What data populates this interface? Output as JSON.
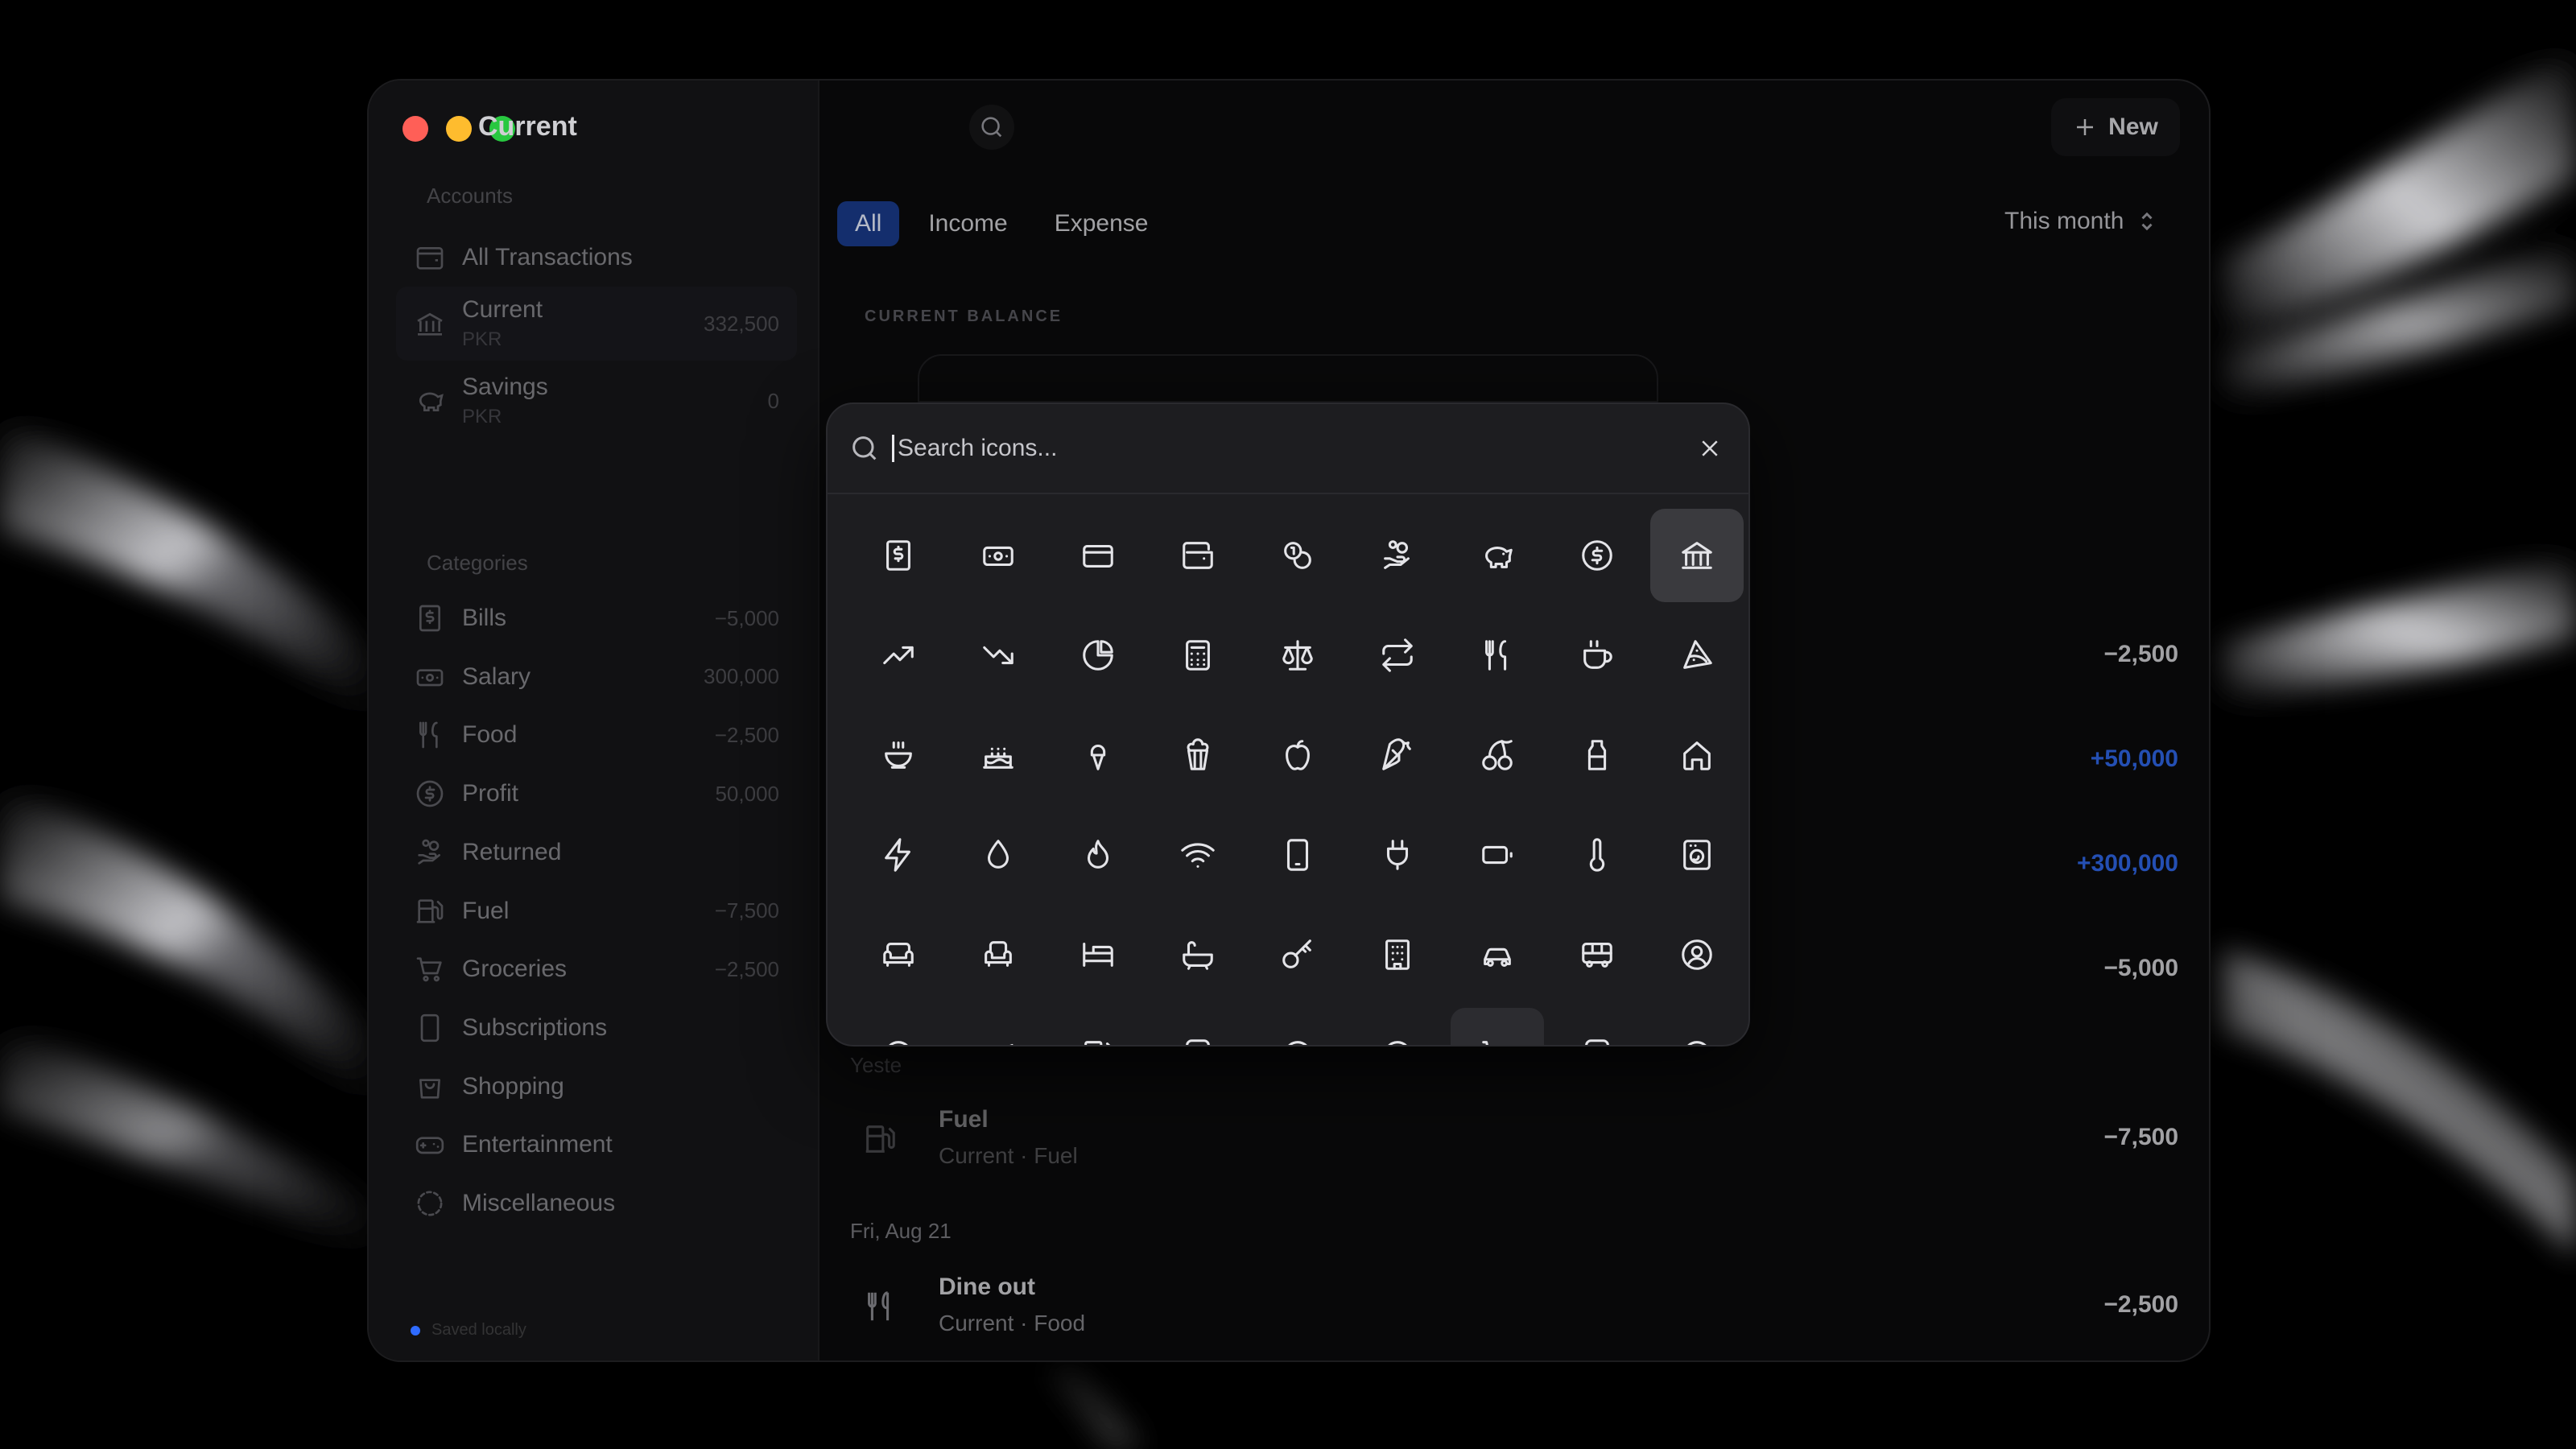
{
  "sidebar": {
    "accounts_label": "Accounts",
    "all_transactions": "All Transactions",
    "accounts": [
      {
        "name": "Current",
        "currency": "PKR",
        "amount": "332,500",
        "icon": "bank-icon"
      },
      {
        "name": "Savings",
        "currency": "PKR",
        "amount": "0",
        "icon": "piggy-bank-icon"
      }
    ],
    "categories_label": "Categories",
    "categories": [
      {
        "name": "Bills",
        "amount": "−5,000",
        "icon": "receipt-icon"
      },
      {
        "name": "Salary",
        "amount": "300,000",
        "icon": "banknote-icon"
      },
      {
        "name": "Food",
        "amount": "−2,500",
        "icon": "utensils-icon"
      },
      {
        "name": "Profit",
        "amount": "50,000",
        "icon": "dollar-circle-icon"
      },
      {
        "name": "Returned",
        "amount": "",
        "icon": "hand-coins-icon"
      },
      {
        "name": "Fuel",
        "amount": "−7,500",
        "icon": "fuel-icon"
      },
      {
        "name": "Groceries",
        "amount": "−2,500",
        "icon": "cart-icon"
      },
      {
        "name": "Subscriptions",
        "amount": "",
        "icon": "phone-icon"
      },
      {
        "name": "Shopping",
        "amount": "",
        "icon": "bag-icon"
      },
      {
        "name": "Entertainment",
        "amount": "",
        "icon": "gamepad-icon"
      },
      {
        "name": "Miscellaneous",
        "amount": "",
        "icon": "dashed-circle-icon"
      }
    ],
    "sync_text": "Saved locally"
  },
  "header": {
    "title": "Current",
    "new_button": "New"
  },
  "filters": {
    "tabs": [
      "All",
      "Income",
      "Expense"
    ],
    "active_tab": "All",
    "period": "This month"
  },
  "balance_label": "CURRENT BALANCE",
  "amounts": [
    "−2,500",
    "+50,000",
    "+300,000",
    "−5,000"
  ],
  "transactions": {
    "partial_date": "Yeste",
    "fuel": {
      "title": "Fuel",
      "sub": "Current · Fuel",
      "amount": "−7,500"
    },
    "date2": "Fri, Aug 21",
    "dine": {
      "title": "Dine out",
      "sub": "Current · Food",
      "amount": "−2,500"
    }
  },
  "picker": {
    "placeholder": "Search icons...",
    "selected_icon": "landmark-icon"
  }
}
